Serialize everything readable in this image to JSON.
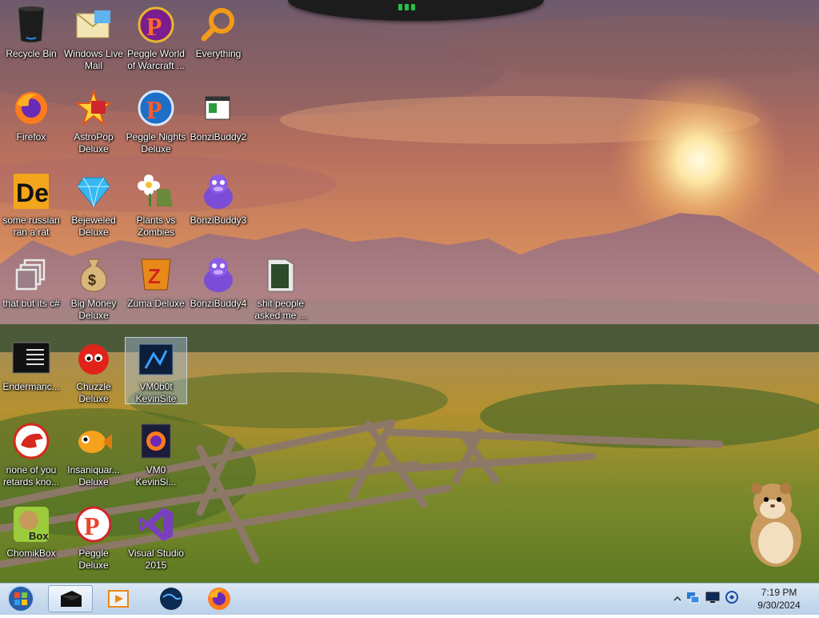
{
  "desktop": {
    "icons": [
      {
        "label": "Recycle Bin",
        "icon": "recycle-bin-icon"
      },
      {
        "label": "Windows Live\nMail",
        "icon": "mail-icon"
      },
      {
        "label": "Peggle World\nof Warcraft ...",
        "icon": "peggle-wow-icon"
      },
      {
        "label": "Everything",
        "icon": "search-magnifier-icon"
      },
      {
        "label": "Firefox",
        "icon": "firefox-icon"
      },
      {
        "label": "AstroPop\nDeluxe",
        "icon": "astropop-icon"
      },
      {
        "label": "Peggle Nights\nDeluxe",
        "icon": "peggle-nights-icon"
      },
      {
        "label": "BonziBuddy2",
        "icon": "file-icon"
      },
      {
        "label": "some russian\nran a rat",
        "icon": "de-icon"
      },
      {
        "label": "Bejeweled\nDeluxe",
        "icon": "gem-icon"
      },
      {
        "label": "Plants vs\nZombies",
        "icon": "flower-icon"
      },
      {
        "label": "BonziBuddy3",
        "icon": "purple-gorilla-icon"
      },
      {
        "label": "that but its c#",
        "icon": "windows-stack-icon"
      },
      {
        "label": "Big Money\nDeluxe",
        "icon": "money-bag-icon"
      },
      {
        "label": "Zuma Deluxe",
        "icon": "zuma-icon"
      },
      {
        "label": "BonziBuddy4",
        "icon": "purple-gorilla-icon"
      },
      {
        "label": "shit people\nasked me ...",
        "icon": "folder-icon"
      },
      {
        "label": "Endermanc...",
        "icon": "console-icon"
      },
      {
        "label": "Chuzzle\nDeluxe",
        "icon": "chuzzle-icon"
      },
      {
        "label": "VM0b0t\nKevinSite",
        "icon": "monitor-icon"
      },
      {
        "label": "none of you\nretards kno...",
        "icon": "red-dinosaur-icon"
      },
      {
        "label": "Insaniquar...\nDeluxe",
        "icon": "fish-icon"
      },
      {
        "label": "VM0\nKevinSi...",
        "icon": "firefox-file-icon"
      },
      {
        "label": "ChomikBox",
        "icon": "hamster-box-icon"
      },
      {
        "label": "Peggle Deluxe",
        "icon": "peggle-icon"
      },
      {
        "label": "Visual Studio\n2015",
        "icon": "visual-studio-icon"
      }
    ],
    "selected_label": "VM0b0t\nKevinSite"
  },
  "taskbar": {
    "start": "windows-start-orb-icon",
    "pinned": [
      "black-box-app-icon",
      "media-player-icon",
      "globe-icon",
      "firefox-icon"
    ],
    "tray_icons": [
      "show-hidden-icons-arrow",
      "network-icon",
      "display-icon",
      "volume-icon"
    ],
    "time": "7:19 PM",
    "date": "9/30/2024"
  },
  "colors": {
    "taskbar_top": "#dbe8f5",
    "taskbar_bottom": "#b9d0e8",
    "label_text": "#ffffff"
  }
}
